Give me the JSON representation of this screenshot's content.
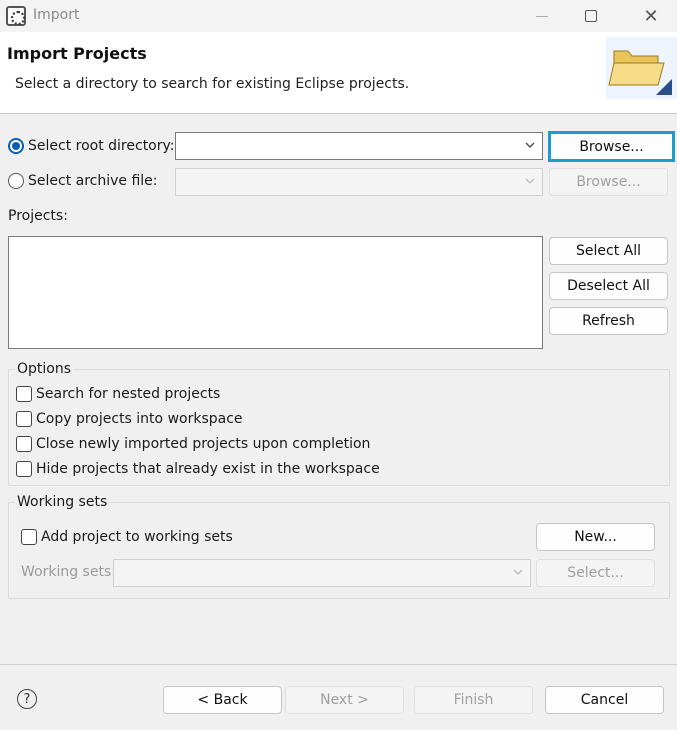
{
  "window": {
    "title": "Import",
    "close_glyph": "✕"
  },
  "header": {
    "title": "Import Projects",
    "description": "Select a directory to search for existing Eclipse projects."
  },
  "source": {
    "root_directory_label": "Select root directory:",
    "root_directory_value": "",
    "archive_file_label": "Select archive file:",
    "archive_file_value": "",
    "browse_label": "Browse...",
    "browse_archive_label": "Browse..."
  },
  "projects": {
    "label": "Projects:",
    "items": [],
    "select_all_label": "Select All",
    "deselect_all_label": "Deselect All",
    "refresh_label": "Refresh"
  },
  "options": {
    "label": "Options",
    "items": [
      {
        "label": "Search for nested projects",
        "checked": false
      },
      {
        "label": "Copy projects into workspace",
        "checked": false
      },
      {
        "label": "Close newly imported projects upon completion",
        "checked": false
      },
      {
        "label": "Hide projects that already exist in the workspace",
        "checked": false
      }
    ]
  },
  "working_sets": {
    "label": "Working sets",
    "add_label": "Add project to working sets",
    "add_checked": false,
    "sets_label": "Working sets:",
    "sets_value": "",
    "new_label": "New...",
    "select_label": "Select..."
  },
  "footer": {
    "help_glyph": "?",
    "back_label": "< Back",
    "next_label": "Next >",
    "finish_label": "Finish",
    "cancel_label": "Cancel"
  },
  "colors": {
    "focus_border": "#1a9bd1",
    "radio_selected": "#0a5fb0"
  },
  "icons": [
    "app-icon",
    "minimize-icon",
    "maximize-icon",
    "close-icon",
    "folder-icon",
    "chevron-down-icon",
    "help-icon"
  ]
}
